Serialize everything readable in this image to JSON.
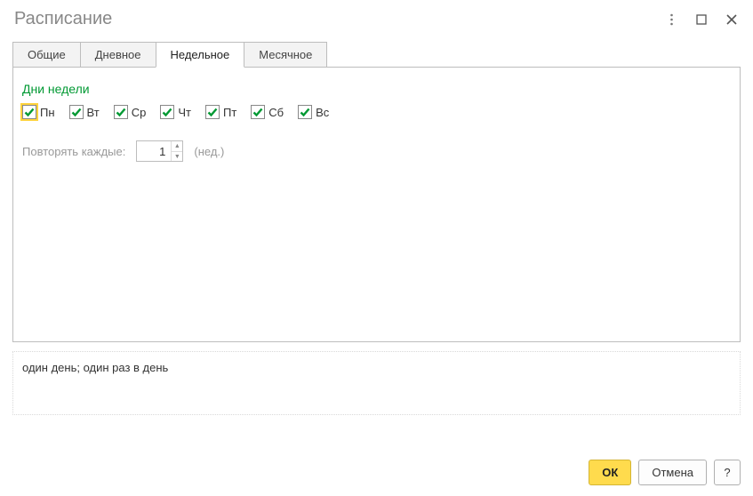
{
  "window": {
    "title": "Расписание"
  },
  "tabs": [
    {
      "label": "Общие"
    },
    {
      "label": "Дневное"
    },
    {
      "label": "Недельное",
      "active": true
    },
    {
      "label": "Месячное"
    }
  ],
  "section": {
    "days_title": "Дни недели"
  },
  "days": [
    {
      "label": "Пн",
      "checked": true
    },
    {
      "label": "Вт",
      "checked": true
    },
    {
      "label": "Ср",
      "checked": true
    },
    {
      "label": "Чт",
      "checked": true
    },
    {
      "label": "Пт",
      "checked": true
    },
    {
      "label": "Сб",
      "checked": true
    },
    {
      "label": "Вс",
      "checked": true
    }
  ],
  "repeat": {
    "label": "Повторять каждые:",
    "value": "1",
    "unit": "(нед.)"
  },
  "description": "один день; один раз в день",
  "footer": {
    "ok": "ОК",
    "cancel": "Отмена",
    "help": "?"
  }
}
